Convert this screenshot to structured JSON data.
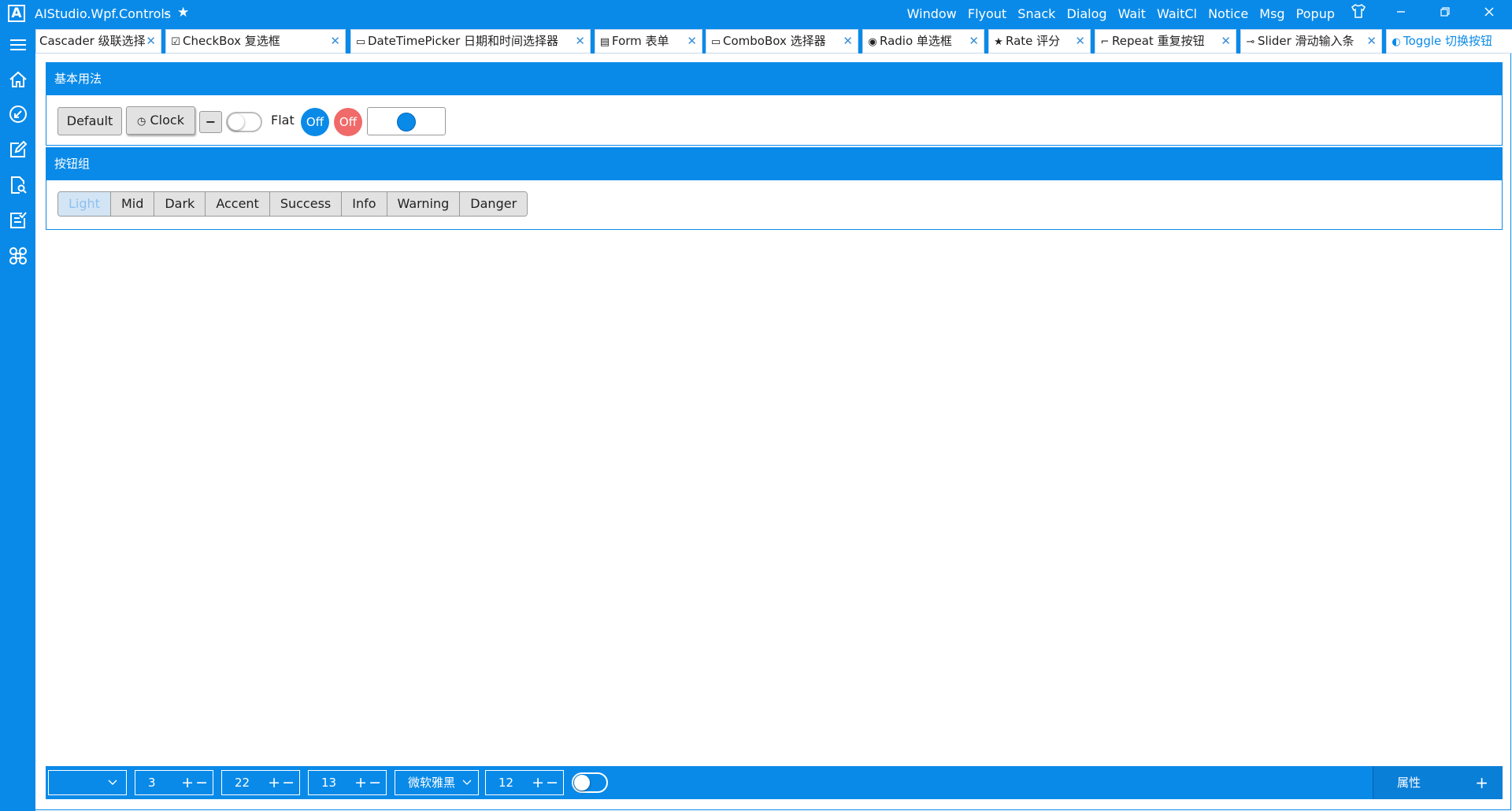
{
  "titlebar": {
    "app_title": "AIStudio.Wpf.Controls",
    "menu": [
      "Window",
      "Flyout",
      "Snack",
      "Dialog",
      "Wait",
      "WaitCl",
      "Notice",
      "Msg",
      "Popup"
    ]
  },
  "sidebar": {
    "items": [
      "menu-icon",
      "home-icon",
      "compass-icon",
      "edit-icon",
      "document-search-icon",
      "checklist-icon",
      "command-icon"
    ]
  },
  "tabs": [
    {
      "label": "Cascader 级联选择",
      "icon": ""
    },
    {
      "label": "CheckBox 复选框",
      "icon": "☑"
    },
    {
      "label": "DateTimePicker 日期和时间选择器",
      "icon": "▭"
    },
    {
      "label": "Form 表单",
      "icon": "▤"
    },
    {
      "label": "ComboBox 选择器",
      "icon": "▭"
    },
    {
      "label": "Radio 单选框",
      "icon": "◉"
    },
    {
      "label": "Rate 评分",
      "icon": "★"
    },
    {
      "label": "Repeat 重复按钮",
      "icon": "⌐"
    },
    {
      "label": "Slider 滑动输入条",
      "icon": "⊸"
    },
    {
      "label": "Toggle 切换按钮",
      "icon": "◐"
    }
  ],
  "panel_basic": {
    "title": "基本用法",
    "default_label": "Default",
    "clock_label": "Clock",
    "minus_label": "−",
    "flat_label": "Flat",
    "off_blue": "Off",
    "off_red": "Off"
  },
  "panel_group": {
    "title": "按钮组",
    "buttons": [
      "Light",
      "Mid",
      "Dark",
      "Accent",
      "Success",
      "Info",
      "Warning",
      "Danger"
    ]
  },
  "bottombar": {
    "field1": "3",
    "field2": "22",
    "field3": "13",
    "font_name": "微软雅黑",
    "font_size": "12",
    "properties_label": "属性"
  },
  "colors": {
    "accent": "#0a8ae8",
    "danger": "#f06a6a"
  }
}
